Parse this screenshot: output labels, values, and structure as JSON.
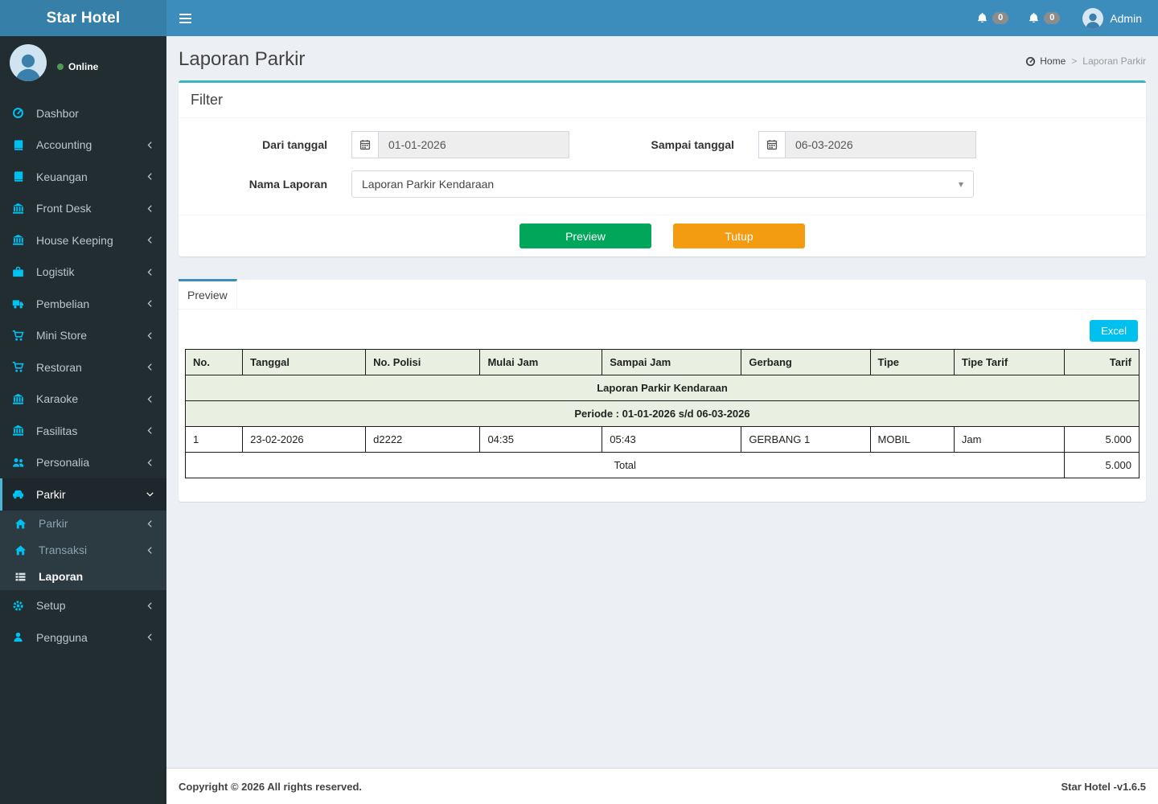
{
  "app": {
    "logo_text": "Star Hotel",
    "footer_left": "Copyright © 2026 All rights reserved.",
    "footer_right": "Star Hotel -v1.6.5"
  },
  "navbar": {
    "notifications": [
      {
        "count": "0"
      },
      {
        "count": "0"
      }
    ],
    "user_name": "Admin"
  },
  "sidebar": {
    "status_label": "Online",
    "items": [
      {
        "label": "Dashbor",
        "icon": "dashboard"
      },
      {
        "label": "Accounting",
        "icon": "book"
      },
      {
        "label": "Keuangan",
        "icon": "book"
      },
      {
        "label": "Front Desk",
        "icon": "bank"
      },
      {
        "label": "House Keeping",
        "icon": "bank"
      },
      {
        "label": "Logistik",
        "icon": "briefcase"
      },
      {
        "label": "Pembelian",
        "icon": "truck"
      },
      {
        "label": "Mini Store",
        "icon": "cart"
      },
      {
        "label": "Restoran",
        "icon": "cart"
      },
      {
        "label": "Karaoke",
        "icon": "bank"
      },
      {
        "label": "Fasilitas",
        "icon": "bank"
      },
      {
        "label": "Personalia",
        "icon": "users"
      },
      {
        "label": "Parkir",
        "icon": "car",
        "active": true
      },
      {
        "label": "Setup",
        "icon": "gears"
      },
      {
        "label": "Pengguna",
        "icon": "user"
      }
    ],
    "parkir_submenu": [
      {
        "label": "Parkir",
        "icon": "home"
      },
      {
        "label": "Transaksi",
        "icon": "home"
      },
      {
        "label": "Laporan",
        "icon": "list",
        "active": true
      }
    ]
  },
  "page": {
    "title": "Laporan Parkir",
    "breadcrumb": {
      "home": "Home",
      "current": "Laporan Parkir"
    }
  },
  "filter": {
    "box_title": "Filter",
    "dari_label": "Dari tanggal",
    "dari_value": "01-01-2026",
    "sampai_label": "Sampai tanggal",
    "sampai_value": "06-03-2026",
    "nama_label": "Nama Laporan",
    "nama_value": "Laporan Parkir Kendaraan",
    "preview_button": "Preview",
    "tutup_button": "Tutup"
  },
  "preview": {
    "tab_label": "Preview",
    "excel_button": "Excel",
    "table": {
      "title": "Laporan Parkir Kendaraan",
      "periode": "Periode : 01-01-2026 s/d 06-03-2026",
      "columns": [
        "No.",
        "Tanggal",
        "No. Polisi",
        "Mulai Jam",
        "Sampai Jam",
        "Gerbang",
        "Tipe",
        "Tipe Tarif",
        "Tarif"
      ],
      "rows": [
        [
          "1",
          "23-02-2026",
          "d2222",
          "04:35",
          "05:43",
          "GERBANG 1",
          "MOBIL",
          "Jam",
          "5.000"
        ]
      ],
      "total_label": "Total",
      "total_value": "5.000"
    }
  },
  "colors": {
    "navbar": "#3c8dbc",
    "logo": "#367fa9",
    "sidebar": "#222d32",
    "sidebar_icon": "#00c0ef",
    "box_top_border": "#39b3c5",
    "green_button": "#00a65a",
    "orange_button": "#f39c12",
    "excel_button": "#00c0ef",
    "table_header_bg": "#e9f0e1",
    "online_dot": "#4e9a51"
  },
  "icon_refs": {
    "dashboard": "#i-dashboard",
    "book": "#i-book",
    "bank": "#i-bank",
    "briefcase": "#i-briefcase",
    "truck": "#i-truck",
    "cart": "#i-cart",
    "users": "#i-users",
    "car": "#i-car",
    "home": "#i-home",
    "list": "#i-list",
    "gears": "#i-gears",
    "user": "#i-user",
    "bell": "#i-bell",
    "calendar": "#i-calendar",
    "chevron_left": "#i-chevron-left",
    "chevron_down": "#i-chevron-down",
    "person": "#i-person"
  }
}
